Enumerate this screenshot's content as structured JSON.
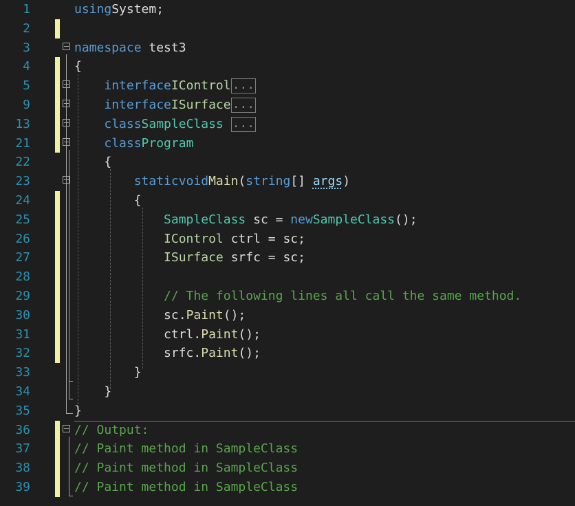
{
  "editor": {
    "lines": [
      {
        "num": "1",
        "changed": false,
        "fold": null,
        "tokens": [
          [
            "kw",
            "using"
          ],
          [
            "",
            "System;"
          ]
        ]
      },
      {
        "num": "2",
        "changed": true,
        "fold": null,
        "tokens": []
      },
      {
        "num": "3",
        "changed": false,
        "fold": "minus",
        "tokens": [
          [
            "kw",
            "namespace"
          ],
          [
            "",
            " test3"
          ]
        ]
      },
      {
        "num": "4",
        "changed": true,
        "fold": null,
        "tokens": [
          [
            "",
            "{"
          ]
        ]
      },
      {
        "num": "5",
        "changed": true,
        "fold": "plus",
        "tokens": [
          [
            "",
            "    "
          ],
          [
            "kw",
            "interface"
          ],
          [
            "",
            ""
          ],
          [
            "ifc",
            "IControl"
          ]
        ],
        "collapsed": "..."
      },
      {
        "num": "9",
        "changed": true,
        "fold": "plus",
        "tokens": [
          [
            "",
            "    "
          ],
          [
            "kw",
            "interface"
          ],
          [
            "",
            ""
          ],
          [
            "ifc",
            "ISurface"
          ]
        ],
        "collapsed": "..."
      },
      {
        "num": "13",
        "changed": true,
        "fold": "plus",
        "tokens": [
          [
            "",
            "    "
          ],
          [
            "kw",
            "class"
          ],
          [
            "",
            ""
          ],
          [
            "ty",
            "SampleClass"
          ],
          [
            "",
            " "
          ]
        ],
        "collapsed": "..."
      },
      {
        "num": "21",
        "changed": true,
        "fold": "minus",
        "tokens": [
          [
            "",
            "    "
          ],
          [
            "kw",
            "class"
          ],
          [
            "",
            ""
          ],
          [
            "ty",
            "Program"
          ]
        ]
      },
      {
        "num": "22",
        "changed": false,
        "fold": null,
        "tokens": [
          [
            "",
            "    {"
          ]
        ]
      },
      {
        "num": "23",
        "changed": false,
        "fold": "minus",
        "tokens": [
          [
            "",
            "        "
          ],
          [
            "kw",
            "static"
          ],
          [
            "",
            ""
          ],
          [
            "kw",
            "void"
          ],
          [
            "",
            ""
          ],
          [
            "fn",
            "Main"
          ],
          [
            "",
            "("
          ],
          [
            "kw",
            "string"
          ],
          [
            "",
            "[] "
          ],
          [
            "par",
            "args"
          ],
          [
            "",
            ")"
          ]
        ]
      },
      {
        "num": "24",
        "changed": true,
        "fold": null,
        "tokens": [
          [
            "",
            "        {"
          ]
        ]
      },
      {
        "num": "25",
        "changed": true,
        "fold": null,
        "tokens": [
          [
            "",
            "            "
          ],
          [
            "ty",
            "SampleClass"
          ],
          [
            "",
            " sc = "
          ],
          [
            "kw",
            "new"
          ],
          [
            "",
            ""
          ],
          [
            "ty",
            "SampleClass"
          ],
          [
            "",
            "();"
          ]
        ]
      },
      {
        "num": "26",
        "changed": true,
        "fold": null,
        "tokens": [
          [
            "",
            "            "
          ],
          [
            "ifc",
            "IControl"
          ],
          [
            "",
            " ctrl = sc;"
          ]
        ]
      },
      {
        "num": "27",
        "changed": true,
        "fold": null,
        "tokens": [
          [
            "",
            "            "
          ],
          [
            "ifc",
            "ISurface"
          ],
          [
            "",
            " srfc = sc;"
          ]
        ]
      },
      {
        "num": "28",
        "changed": true,
        "fold": null,
        "tokens": []
      },
      {
        "num": "29",
        "changed": true,
        "fold": null,
        "tokens": [
          [
            "",
            "            "
          ],
          [
            "cm",
            "// The following lines all call the same method."
          ]
        ]
      },
      {
        "num": "30",
        "changed": true,
        "fold": null,
        "tokens": [
          [
            "",
            "            sc."
          ],
          [
            "fn",
            "Paint"
          ],
          [
            "",
            "();"
          ]
        ]
      },
      {
        "num": "31",
        "changed": true,
        "fold": null,
        "tokens": [
          [
            "",
            "            ctrl."
          ],
          [
            "fn",
            "Paint"
          ],
          [
            "",
            "();"
          ]
        ]
      },
      {
        "num": "32",
        "changed": true,
        "fold": null,
        "tokens": [
          [
            "",
            "            srfc."
          ],
          [
            "fn",
            "Paint"
          ],
          [
            "",
            "();"
          ]
        ]
      },
      {
        "num": "33",
        "changed": false,
        "fold": null,
        "tokens": [
          [
            "",
            "        }"
          ]
        ]
      },
      {
        "num": "34",
        "changed": false,
        "fold": null,
        "tokens": [
          [
            "",
            "    }"
          ]
        ]
      },
      {
        "num": "35",
        "changed": false,
        "fold": null,
        "tokens": [
          [
            "",
            "}"
          ]
        ]
      },
      {
        "num": "36",
        "changed": true,
        "fold": "minus",
        "tokens": [
          [
            "cm",
            "// Output:"
          ]
        ]
      },
      {
        "num": "37",
        "changed": true,
        "fold": null,
        "tokens": [
          [
            "cm",
            "// Paint method in SampleClass"
          ]
        ]
      },
      {
        "num": "38",
        "changed": true,
        "fold": null,
        "tokens": [
          [
            "cm",
            "// Paint method in SampleClass"
          ]
        ]
      },
      {
        "num": "39",
        "changed": true,
        "fold": null,
        "tokens": [
          [
            "cm",
            "// Paint method in SampleClass"
          ]
        ]
      }
    ]
  },
  "colors": {
    "background": "#1e1e1e",
    "line_number": "#2b91af",
    "keyword": "#569cd6",
    "type": "#4ec9b0",
    "interface": "#b8d7a3",
    "method": "#dcdcaa",
    "comment": "#57a64a",
    "change_marker": "#eff0a3"
  }
}
